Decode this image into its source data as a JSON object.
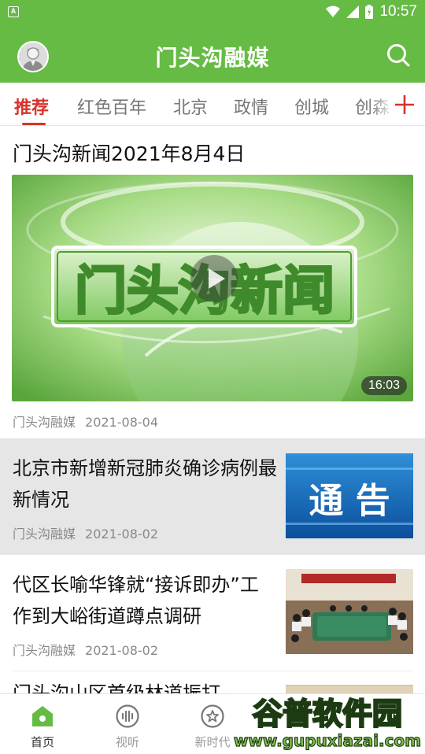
{
  "status_bar": {
    "time": "10:57",
    "sim_letter": "A"
  },
  "header": {
    "title": "门头沟融媒"
  },
  "tabs": [
    {
      "label": "推荐",
      "active": true
    },
    {
      "label": "红色百年"
    },
    {
      "label": "北京"
    },
    {
      "label": "政情"
    },
    {
      "label": "创城"
    },
    {
      "label": "创森"
    }
  ],
  "featured": {
    "title": "门头沟新闻2021年8月4日",
    "thumb_text": "门头沟新闻",
    "duration": "16:03",
    "source": "门头沟融媒",
    "date": "2021-08-04"
  },
  "articles": [
    {
      "title": "北京市新增新冠肺炎确诊病例最新情况",
      "thumb_text": "通 告",
      "source": "门头沟融媒",
      "date": "2021-08-02"
    },
    {
      "title": "代区长喻华锋就“接诉即办”工作到大峪街道蹲点调研",
      "source": "门头沟融媒",
      "date": "2021-08-02"
    },
    {
      "title_partial": "门头沟山区首级林道振打"
    }
  ],
  "bottom_nav": [
    {
      "label": "首页",
      "icon": "home-icon",
      "active": true
    },
    {
      "label": "视听",
      "icon": "audio-wave-icon"
    },
    {
      "label": "新时代",
      "icon": "badge-icon"
    }
  ],
  "watermark": {
    "text": "谷普软件园",
    "url": "www.gupuxiazai.com"
  },
  "colors": {
    "brand_green": "#66bb44",
    "active_red": "#d8322b"
  }
}
